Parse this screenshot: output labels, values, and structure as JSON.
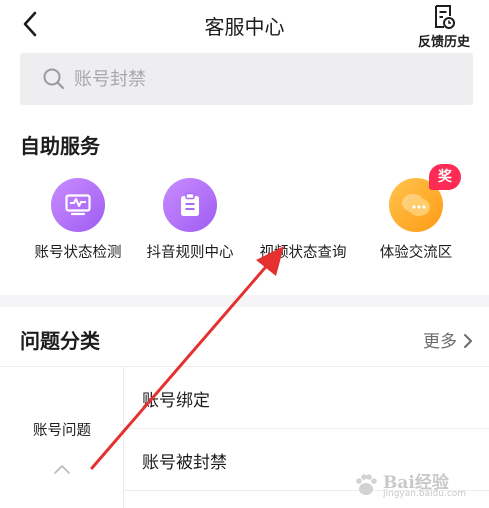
{
  "nav": {
    "title": "客服中心",
    "history_label": "反馈历史"
  },
  "search": {
    "placeholder": "账号封禁"
  },
  "self_service": {
    "title": "自助服务",
    "items": [
      {
        "label": "账号状态检测",
        "icon": "monitor-pulse-icon",
        "color": "#b070f5"
      },
      {
        "label": "抖音规则中心",
        "icon": "clipboard-icon",
        "color": "#b070f5"
      },
      {
        "label": "视频状态查询",
        "icon": "",
        "color": ""
      },
      {
        "label": "体验交流区",
        "icon": "chat-bubbles-icon",
        "color": "#ffac2a",
        "badge": "奖"
      }
    ]
  },
  "categories": {
    "title": "问题分类",
    "more_label": "更多",
    "active_category": "账号问题",
    "questions": [
      "账号绑定",
      "账号被封禁"
    ]
  },
  "watermark": {
    "main": "Bai经验",
    "sub": "jingyan.baidu.com"
  },
  "colors": {
    "annotation_arrow": "#e53030",
    "badge": "#fe2c55"
  }
}
